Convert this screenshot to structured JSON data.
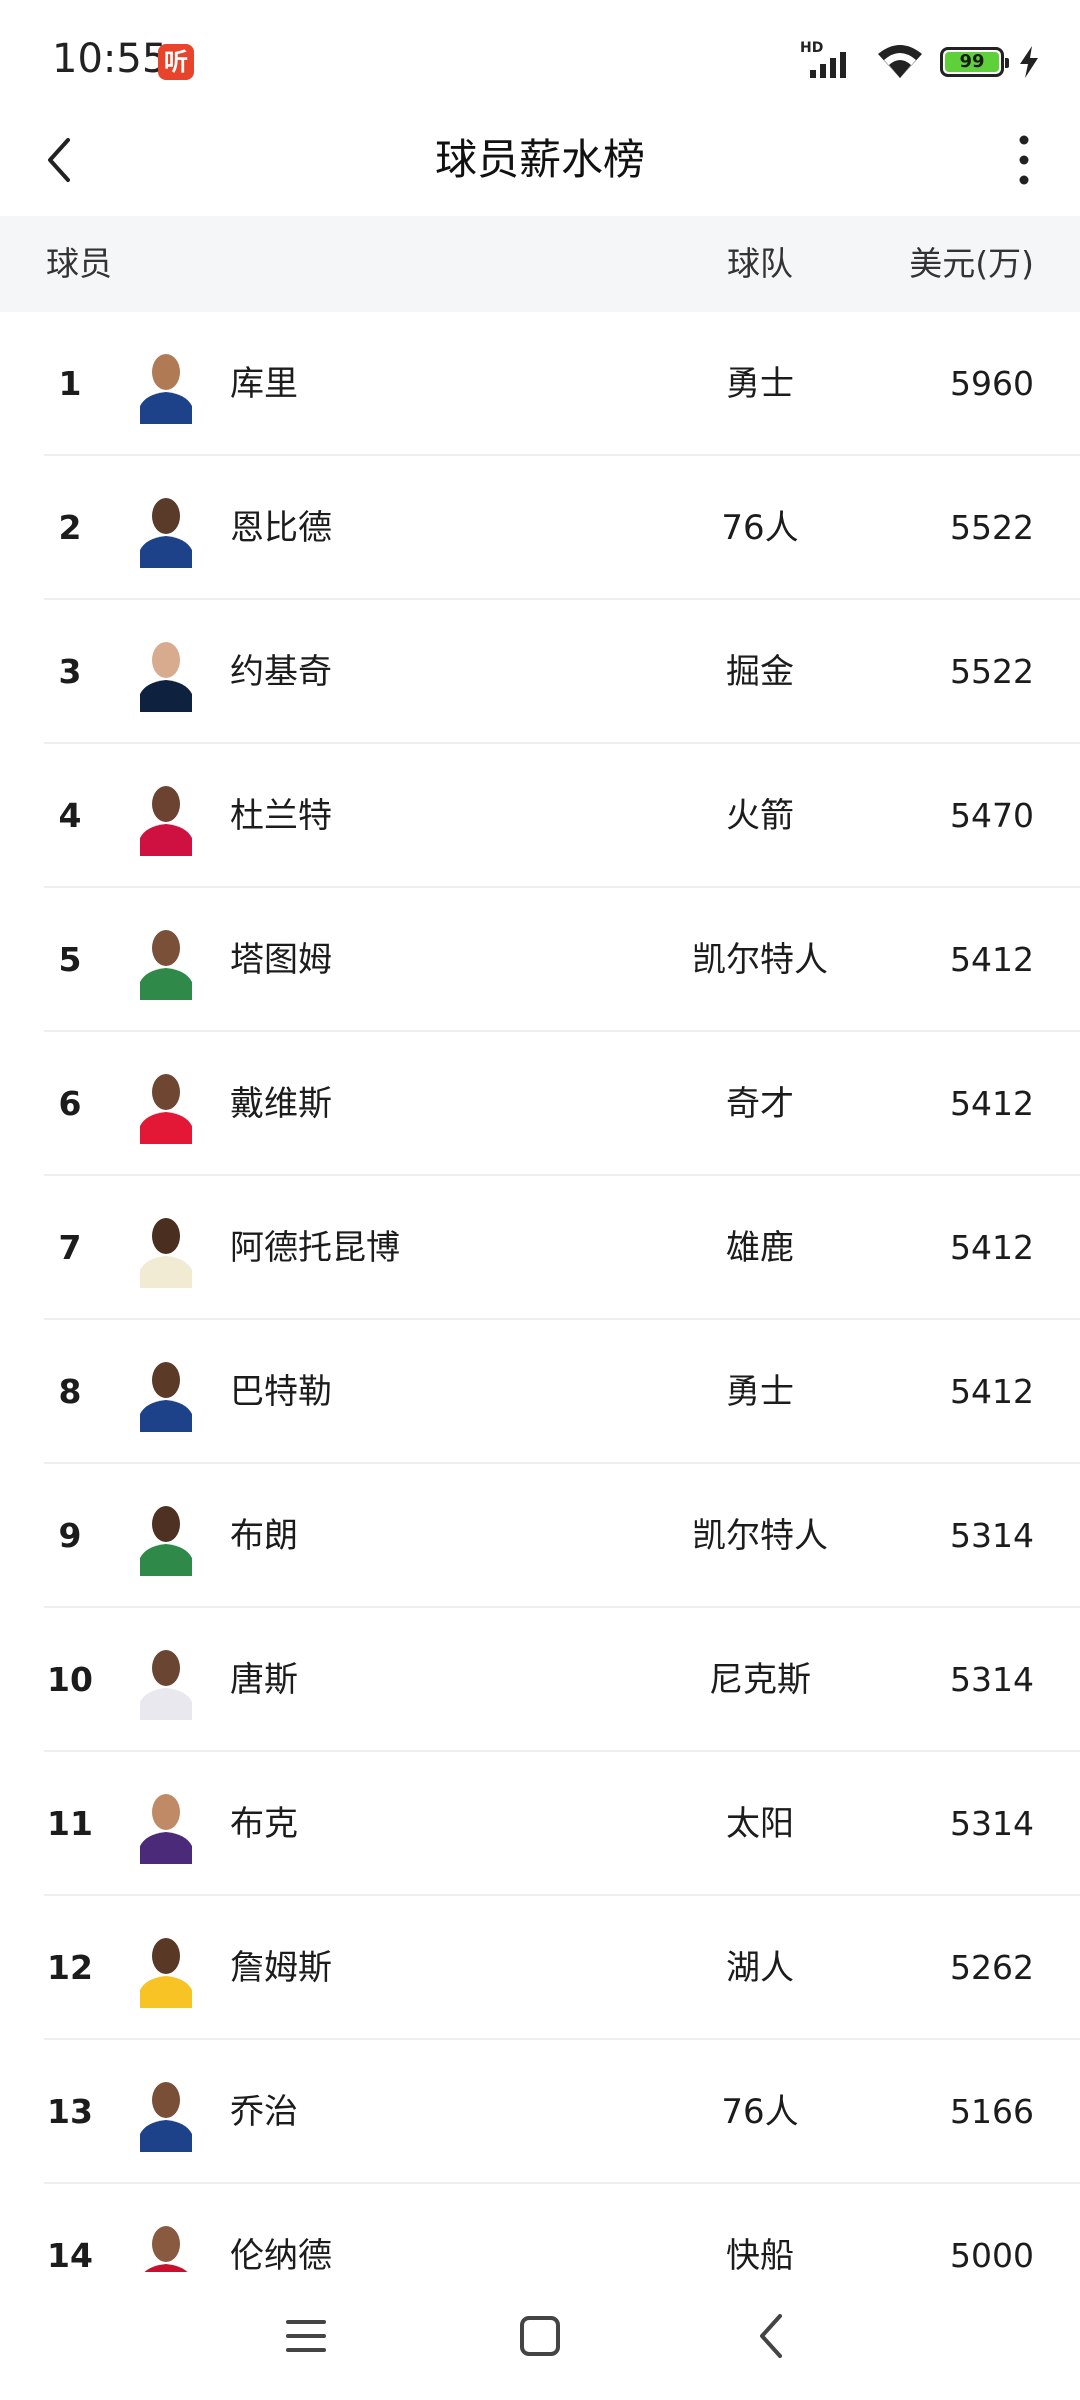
{
  "status_bar": {
    "time": "10:55",
    "app_badge": "听",
    "network_label": "HD",
    "battery": "99"
  },
  "header": {
    "title": "球员薪水榜"
  },
  "columns": {
    "player": "球员",
    "team": "球队",
    "salary": "美元(万)"
  },
  "rows": [
    {
      "rank": "1",
      "name": "库里",
      "team": "勇士",
      "salary": "5960",
      "jersey": "#1d428a"
    },
    {
      "rank": "2",
      "name": "恩比德",
      "team": "76人",
      "salary": "5522",
      "jersey": "#1d428a"
    },
    {
      "rank": "3",
      "name": "约基奇",
      "team": "掘金",
      "salary": "5522",
      "jersey": "#0e2240"
    },
    {
      "rank": "4",
      "name": "杜兰特",
      "team": "火箭",
      "salary": "5470",
      "jersey": "#ce1141"
    },
    {
      "rank": "5",
      "name": "塔图姆",
      "team": "凯尔特人",
      "salary": "5412",
      "jersey": "#2f8a4a"
    },
    {
      "rank": "6",
      "name": "戴维斯",
      "team": "奇才",
      "salary": "5412",
      "jersey": "#e31837"
    },
    {
      "rank": "7",
      "name": "阿德托昆博",
      "team": "雄鹿",
      "salary": "5412",
      "jersey": "#f0ebd2"
    },
    {
      "rank": "8",
      "name": "巴特勒",
      "team": "勇士",
      "salary": "5412",
      "jersey": "#1d428a"
    },
    {
      "rank": "9",
      "name": "布朗",
      "team": "凯尔特人",
      "salary": "5314",
      "jersey": "#2f8a4a"
    },
    {
      "rank": "10",
      "name": "唐斯",
      "team": "尼克斯",
      "salary": "5314",
      "jersey": "#e8e8ee"
    },
    {
      "rank": "11",
      "name": "布克",
      "team": "太阳",
      "salary": "5314",
      "jersey": "#4b2a7a"
    },
    {
      "rank": "12",
      "name": "詹姆斯",
      "team": "湖人",
      "salary": "5262",
      "jersey": "#f7c325"
    },
    {
      "rank": "13",
      "name": "乔治",
      "team": "76人",
      "salary": "5166",
      "jersey": "#1d428a"
    },
    {
      "rank": "14",
      "name": "伦纳德",
      "team": "快船",
      "salary": "5000",
      "jersey": "#c8102e"
    }
  ]
}
